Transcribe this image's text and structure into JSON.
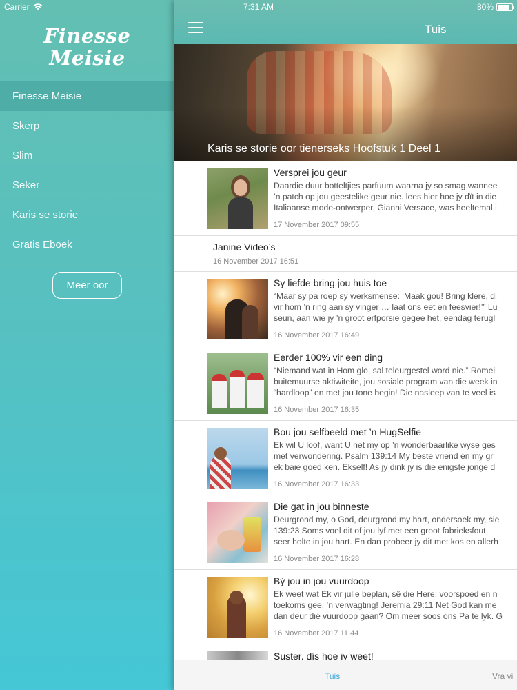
{
  "status": {
    "carrier": "Carrier",
    "time": "7:31 AM",
    "battery": "80%"
  },
  "sidebar": {
    "logo_line1": "Finesse",
    "logo_line2": "Meisie",
    "items": [
      {
        "label": "Finesse Meisie",
        "active": true
      },
      {
        "label": "Skerp"
      },
      {
        "label": "Slim"
      },
      {
        "label": "Seker"
      },
      {
        "label": "Karis se storie"
      },
      {
        "label": "Gratis Eboek"
      }
    ],
    "more_button": "Meer oor"
  },
  "header": {
    "title": "Tuis"
  },
  "hero": {
    "caption": "Karis se storie oor tienerseks Hoofstuk 1 Deel 1"
  },
  "feed": [
    {
      "title": "Versprei jou geur",
      "excerpt": [
        "Daardie duur botteltjies parfuum waarna jy so smag wannee",
        "’n patch op jou geestelike geur nie. lees hier hoe jy dït in die",
        "Italiaanse mode-ontwerper, Gianni Versace, was heeltemal i"
      ],
      "date": "17 November 2017 09:55"
    },
    {
      "title": "Janine Video’s",
      "date": "16 November 2017 16:51"
    },
    {
      "title": "Sy liefde bring jou huis toe",
      "excerpt": [
        "“Maar sy pa roep sy werksmense: ‘Maak gou! Bring klere, di",
        "vir hom ’n ring aan sy vinger … laat ons eet en feesvier!’” Lu",
        "seun, aan wie jy ’n groot erfporsie gegee het, eendag terugl"
      ],
      "date": "16 November 2017 16:49"
    },
    {
      "title": "Eerder 100% vir een ding",
      "excerpt": [
        "“Niemand wat in Hom glo, sal teleurgestel word nie.” Romei",
        "buitemuurse aktiwiteite, jou sosiale program van die week in",
        "“hardloop” en met jou tone begin! Die nasleep van te veel is"
      ],
      "date": "16 November 2017 16:35"
    },
    {
      "title": "Bou jou selfbeeld met ’n HugSelfie",
      "excerpt": [
        "Ek wil U loof, want U het my op ’n wonderbaarlike wyse ges",
        "met verwondering. Psalm 139:14   My beste vriend én my gr",
        "ek baie goed ken. Ekself!  As jy dink jy is die enigste jonge d"
      ],
      "date": "16 November 2017 16:33"
    },
    {
      "title": "Die gat in jou binneste",
      "excerpt": [
        "Deurgrond my, o God, deurgrond my hart, ondersoek my, sie",
        "139:23   Soms voel dit of jou lyf met een groot fabrieksfout",
        "seer holte in jou hart. En dan probeer jy dit met kos en allerh"
      ],
      "date": "16 November 2017 16:28"
    },
    {
      "title": "Bý jou in jou vuurdoop",
      "excerpt": [
        "Ek weet wat Ek vir julle beplan, sê die Here: voorspoed en n",
        "toekoms gee, ’n verwagting! Jeremia 29:11   Net God kan me",
        "dan deur dié vuurdoop gaan? Om meer soos ons Pa te lyk. G"
      ],
      "date": "16 November 2017 11:44"
    }
  ],
  "partial_item_title": "Suster, dís hoe jy weet!",
  "tabbar": {
    "home": "Tuis",
    "ask": "Vra vi"
  }
}
